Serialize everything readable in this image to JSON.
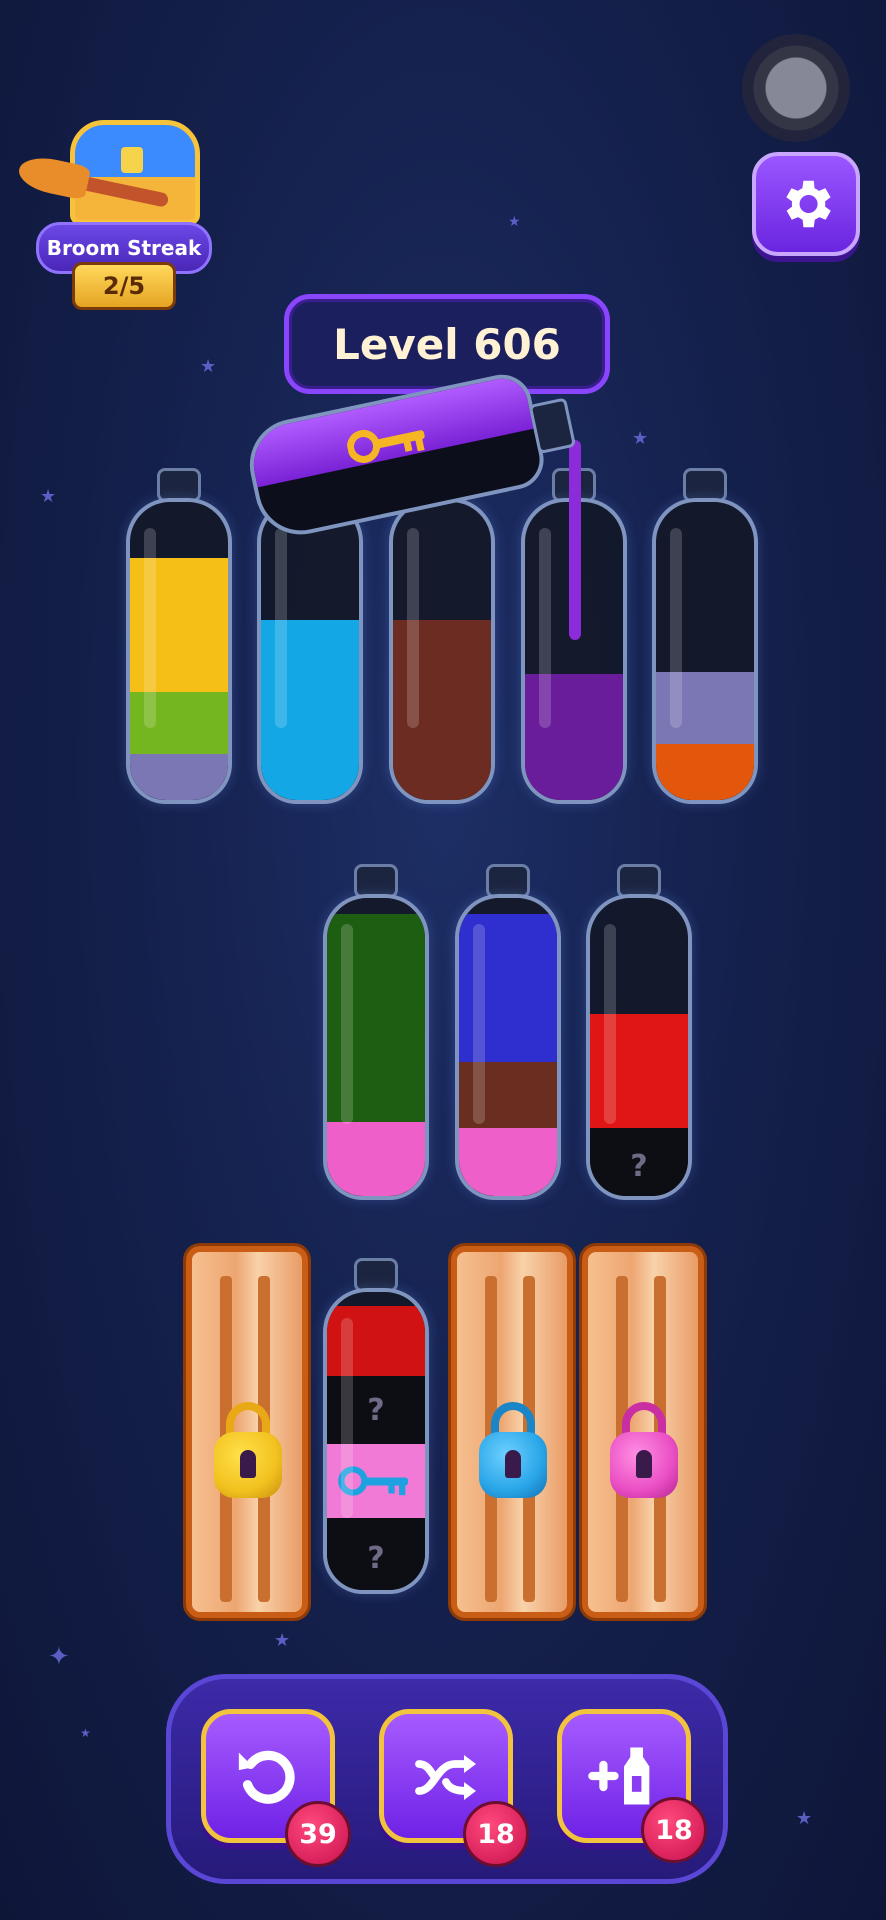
{
  "header": {
    "streak_title": "Broom Streak",
    "streak_count": "2/5",
    "level_label": "Level 606",
    "settings_icon": "gear-icon"
  },
  "bottles": {
    "row1": [
      {
        "layers": [
          "#f5bf17",
          "#f5bf17",
          "#74b61f",
          "#7b76b4"
        ]
      },
      {
        "layers": [
          "#13a8e5",
          "#13a8e5",
          "#13a8e5"
        ]
      },
      {
        "layers": [
          "#6d2c22",
          "#6d2c22",
          "#6d2c22"
        ]
      },
      {
        "layers": [
          "#6a1d9b",
          "#6a1d9b"
        ]
      },
      {
        "layers": [
          "#7b76b4",
          "#e3570c"
        ]
      }
    ],
    "poured_bottle": {
      "layer": "#8f38e0",
      "item": "key-icon"
    },
    "row2": [
      {
        "layers": [
          "#1e5e12",
          "#1e5e12",
          "#1e5e12",
          "#ee5fc9"
        ]
      },
      {
        "layers": [
          "#2f2fcf",
          "#2f2fcf",
          "#6a2e20",
          "#ee5fc9"
        ]
      },
      {
        "layers": [
          "#e01616",
          "#e01616",
          "#0d0d14"
        ],
        "hidden": "?"
      }
    ],
    "row3_bottle": {
      "layers": [
        "#d11212",
        "#0d0d14",
        "#f07ad6",
        "#0d0d14"
      ],
      "hidden": "?"
    }
  },
  "locked_panels": [
    {
      "lock_color": "#f2c21f",
      "name": "yellow"
    },
    {
      "lock_color": "#29a6e8",
      "name": "blue"
    },
    {
      "lock_color": "#ea4fc4",
      "name": "pink"
    }
  ],
  "toolbar": {
    "undo_count": "39",
    "shuffle_count": "18",
    "add_bottle_count": "18"
  }
}
